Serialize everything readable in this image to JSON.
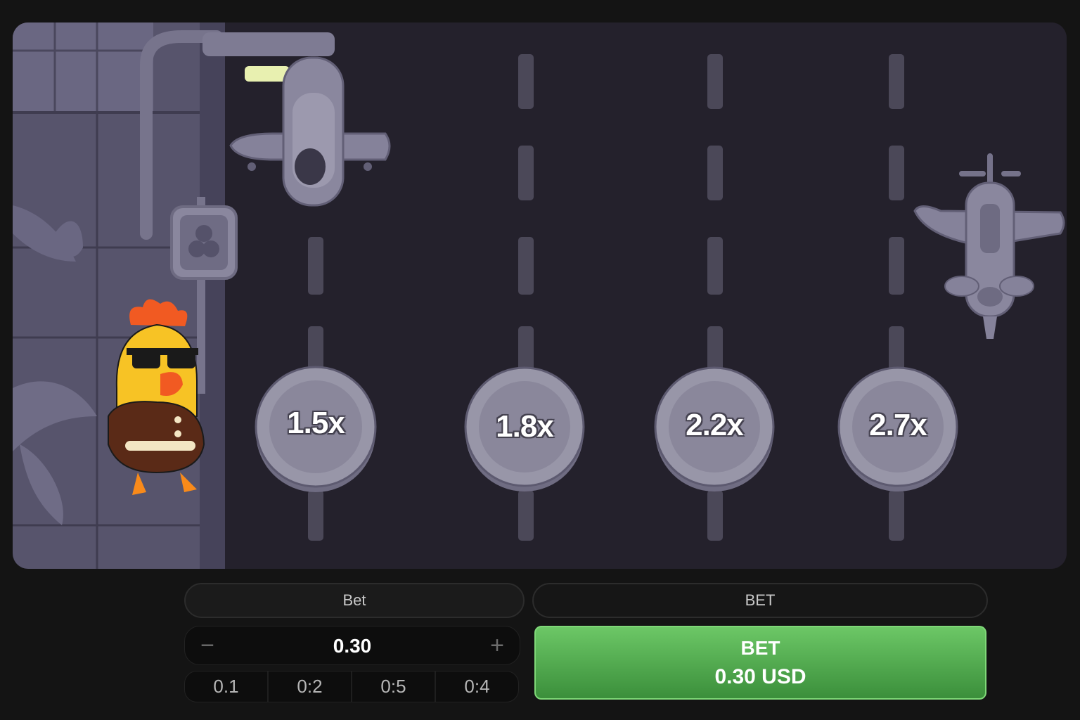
{
  "multipliers": [
    "1.5x",
    "1.8x",
    "2.2x",
    "2.7x"
  ],
  "controls": {
    "bet_tab_label": "Bet",
    "mode_label": "BET",
    "amount_value": "0.30",
    "minus_symbol": "−",
    "plus_symbol": "+",
    "quick_amounts": [
      "0.1",
      "0:2",
      "0:5",
      "0:4"
    ],
    "bet_button_line1": "BET",
    "bet_button_line2": "0.30 USD"
  },
  "colors": {
    "road": "#24212c",
    "sidewalk": "#55526a",
    "coin": "#8e8b9b",
    "bet_button": "#4ea84a",
    "chicken": "#f7c325"
  }
}
